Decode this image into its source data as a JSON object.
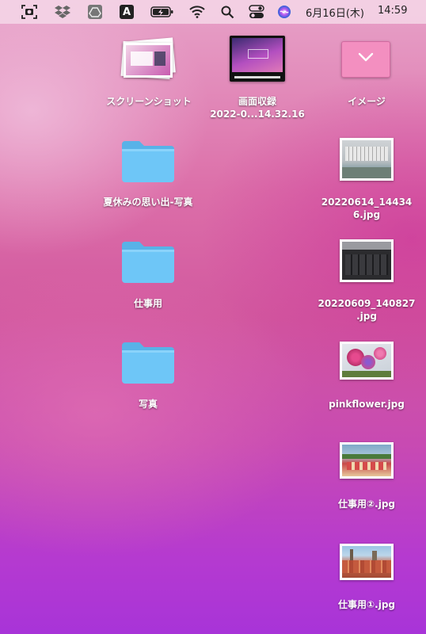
{
  "menubar": {
    "date": "6月16日(木)",
    "time": "14:59",
    "keyboard_indicator": "A"
  },
  "desktop": {
    "items": [
      {
        "name": "スクリーンショット"
      },
      {
        "name": "画面収録",
        "sub": "2022-0...14.32.16"
      },
      {
        "name": "イメージ"
      },
      {
        "name": "夏休みの思い出-写真"
      },
      {
        "name": "20220614_14434",
        "sub": "6.jpg"
      },
      {
        "name": "仕事用"
      },
      {
        "name": "20220609_140827",
        "sub": ".jpg"
      },
      {
        "name": "写真"
      },
      {
        "name": "pinkflower.jpg"
      },
      {
        "name": "仕事用②.jpg"
      },
      {
        "name": "仕事用①.jpg"
      }
    ]
  },
  "colors": {
    "folder": "#6ec6f7",
    "folder_tab": "#58b2e8",
    "menubar_bg": "#f5d7e8"
  }
}
